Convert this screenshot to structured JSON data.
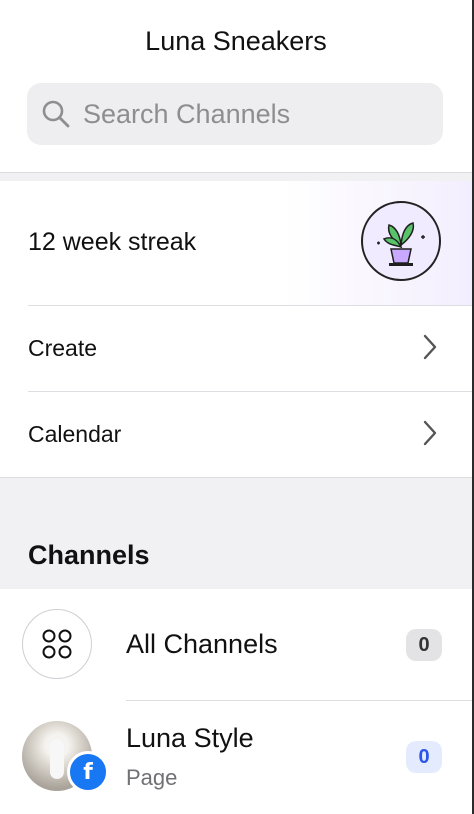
{
  "header": {
    "title": "Luna Sneakers",
    "search_placeholder": "Search Channels"
  },
  "streak": {
    "label": "12 week streak",
    "badge_icon": "plant-icon"
  },
  "menu": [
    {
      "label": "Create",
      "icon": "chevron-right-icon"
    },
    {
      "label": "Calendar",
      "icon": "chevron-right-icon"
    }
  ],
  "channels_section": {
    "heading": "Channels",
    "all": {
      "name": "All Channels",
      "count": "0",
      "icon": "grid-icon"
    },
    "items": [
      {
        "name": "Luna Style",
        "type": "Page",
        "count": "0",
        "network": "facebook-icon",
        "network_glyph": "f"
      }
    ]
  },
  "colors": {
    "accent_blue": "#2b56e8",
    "facebook_blue": "#1877f2",
    "streak_tint": "#f3eefe"
  }
}
